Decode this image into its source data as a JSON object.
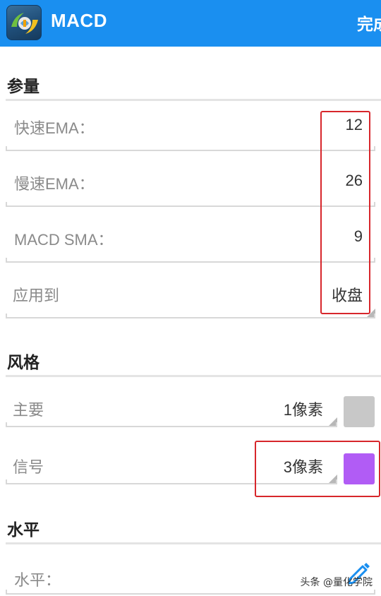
{
  "appbar": {
    "title": "MACD",
    "done_label": "完成",
    "icon": "metatrader-app-icon",
    "background": "#1a8ff0"
  },
  "sections": {
    "params": {
      "title": "参量",
      "fast_ema": {
        "label": "快速EMA：",
        "value": "12"
      },
      "slow_ema": {
        "label": "慢速EMA：",
        "value": "26"
      },
      "macd_sma": {
        "label": "MACD SMA：",
        "value": "9"
      },
      "apply_to": {
        "label": "应用到",
        "value": "收盘"
      }
    },
    "style": {
      "title": "风格",
      "main": {
        "label": "主要",
        "width": "1像素",
        "color": "#c8c8c8"
      },
      "signal": {
        "label": "信号",
        "width": "3像素",
        "color": "#b15cf5"
      }
    },
    "levels": {
      "title": "水平",
      "level": {
        "label": "水平：",
        "edit_icon": "pencil-icon"
      }
    }
  },
  "watermark": "头条 @量化学院"
}
